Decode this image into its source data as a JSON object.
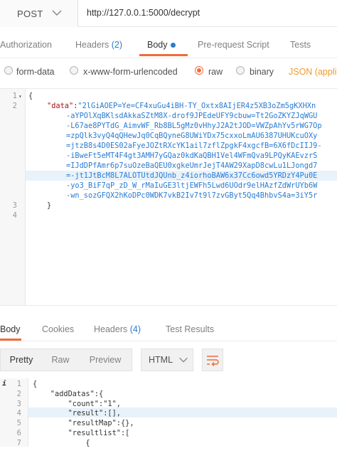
{
  "request": {
    "method": "POST",
    "url": "http://127.0.0.1:5000/decrypt"
  },
  "req_tabs": {
    "authorization": "Authorization",
    "headers": "Headers",
    "headers_count": "(2)",
    "body": "Body",
    "prerequest": "Pre-request Script",
    "tests": "Tests"
  },
  "body_types": {
    "form_data": "form-data",
    "urlencoded": "x-www-form-urlencoded",
    "raw": "raw",
    "binary": "binary",
    "json_select": "JSON (applic"
  },
  "request_editor": {
    "line_numbers": [
      "1",
      "2",
      "3",
      "4"
    ],
    "line1": "{",
    "key": "\"data\"",
    "colon": ":",
    "value_lines": [
      "\"2lGiAOEP=Ye=CF4xuGu4iBH-TY_Oxtx8AIjER4z5XB3oZm5gKXHXn",
      "-aYPOlXqBKlsdAkkaSZtM8X-drof9JPEdeUFY9cbuw=Tt2GoZKYZJqWGU",
      "-L67ae8PYTdG_AimvWF_Rb8BL5gMz0vHhyJ2A2tJOD=VWZpAhYv5rWG7Op",
      "=zpQlk3vyQ4qQHewJq0CqBQyneG8UWiYDx75cxxoLmAU6387UHUKcuOXy",
      "=jtzB8s4D0ES02aFyeJOZtRXcYK1ail7zflZpgkF4xgcfB=6X6fDcIIJ9-",
      "-iBweFt5eMT4F4gt3AMH7yGQaz0kdKaQBH1Vel4WFmQva9LPQyKAEvzrS",
      "=IJdDPfAmr6p7suOzeBaQEU0xgkeUmrJejT4AW29XapD8cwLu1LJongd7",
      "=-jt1JtBcM8L7ALOTUtdJQUnb_z4iorhoBAW6x37Cc6owd5YRDzY4Pu0E",
      "-yo3_BiF7qP_zD_W_rMaIuGE3ltjEWFh5Lwd6UOdr9elHAzfZdWrUYb6W",
      "-wn_sozGFQX2hKoDPc0WDK7vkB2Iv7t9l7zvGByt5Qq4BhbvS4a=3iY5r"
    ],
    "line3": "}"
  },
  "resp_tabs": {
    "body": "Body",
    "cookies": "Cookies",
    "headers": "Headers",
    "headers_count": "(4)",
    "test_results": "Test Results"
  },
  "resp_toolbar": {
    "pretty": "Pretty",
    "raw": "Raw",
    "preview": "Preview",
    "format": "HTML"
  },
  "response_editor": {
    "line_numbers": [
      "1",
      "2",
      "3",
      "4",
      "5",
      "6",
      "7"
    ],
    "info_marker": "i",
    "lines": [
      "{",
      "    \"addDatas\":{",
      "        \"count\":\"1\",",
      "        \"result\":[],",
      "        \"resultMap\":{},",
      "        \"resultlist\":[",
      "            {"
    ]
  },
  "colors": {
    "accent": "#f26b3a",
    "link_blue": "#2a7bd1",
    "json_orange": "#f09a2a"
  }
}
